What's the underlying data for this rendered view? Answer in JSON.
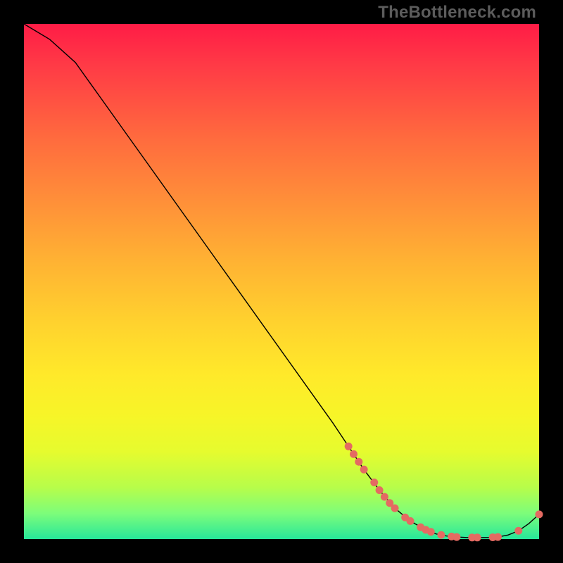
{
  "watermark": "TheBottleneck.com",
  "chart_data": {
    "type": "line",
    "title": "",
    "xlabel": "",
    "ylabel": "",
    "xlim": [
      0,
      100
    ],
    "ylim": [
      0,
      100
    ],
    "gradient_note": "Vertical red→yellow→green heat gradient; green band near y≈0 indicating optimal region",
    "series": [
      {
        "name": "bottleneck-curve",
        "x": [
          0,
          5,
          10,
          15,
          20,
          25,
          30,
          35,
          40,
          45,
          50,
          55,
          60,
          63,
          66,
          69,
          72,
          75,
          78,
          80,
          82,
          84,
          86,
          88,
          90,
          92,
          94,
          96,
          98,
          100
        ],
        "y": [
          100,
          97,
          92.5,
          85.5,
          78.5,
          71.5,
          64.5,
          57.5,
          50.5,
          43.5,
          36.5,
          29.5,
          22.5,
          18,
          13.5,
          9.5,
          6,
          3.5,
          1.8,
          1.0,
          0.6,
          0.4,
          0.3,
          0.3,
          0.3,
          0.4,
          0.8,
          1.6,
          3.0,
          4.8
        ]
      },
      {
        "name": "highlight-dots",
        "x": [
          63,
          64,
          65,
          66,
          68,
          69,
          70,
          71,
          72,
          74,
          75,
          77,
          78,
          79,
          81,
          83,
          84,
          87,
          88,
          91,
          92,
          96,
          100
        ],
        "y": [
          18,
          16.5,
          15,
          13.5,
          11,
          9.5,
          8.2,
          7,
          6,
          4.2,
          3.5,
          2.3,
          1.8,
          1.4,
          0.8,
          0.5,
          0.4,
          0.3,
          0.3,
          0.35,
          0.4,
          1.6,
          4.8
        ]
      }
    ]
  }
}
